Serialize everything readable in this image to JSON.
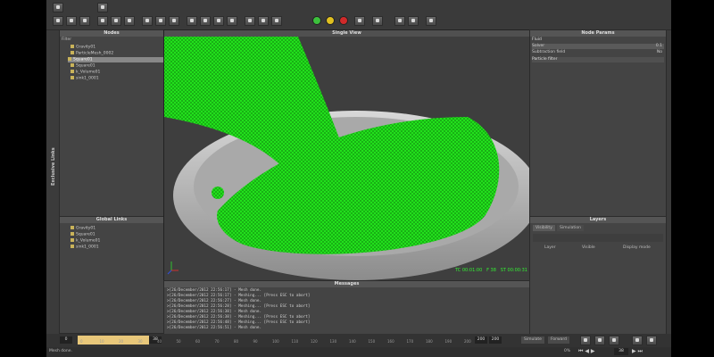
{
  "nodes_panel": {
    "title": "Nodes",
    "filter_label": "Filter",
    "items": [
      {
        "label": "Gravity01"
      },
      {
        "label": "ParticleMesh_0002"
      },
      {
        "label": "Square01"
      },
      {
        "label": "Square01"
      },
      {
        "label": "k_Volume01"
      },
      {
        "label": "sink1_0001"
      }
    ]
  },
  "side_tab": {
    "label": "Exclusive Links"
  },
  "global_links": {
    "title": "Global Links",
    "items": [
      {
        "label": "Gravity01"
      },
      {
        "label": "Square01"
      },
      {
        "label": "k_Volume01"
      },
      {
        "label": "sink1_0001"
      }
    ]
  },
  "viewport": {
    "title": "Single View",
    "hud": {
      "tc": "TC 00:01:00",
      "frame": "F 38",
      "st": "ST 00:00:31"
    }
  },
  "node_params": {
    "title": "Node Params",
    "section": "Fluid",
    "rows": [
      {
        "label": "Solver",
        "value": "0.1"
      },
      {
        "label": "Subtraction field",
        "value": "No"
      }
    ],
    "subsection": "Particle filter"
  },
  "layers": {
    "title": "Layers",
    "tabs": [
      "Visibility",
      "Simulation"
    ],
    "columns": [
      "Layer",
      "Visible",
      "Display mode"
    ]
  },
  "messages": {
    "title": "Messages",
    "lines": [
      ">[26/December/2012 22:56:17] - Mesh done.",
      ">[26/December/2012 22:56:17] - Meshing... [Press ESC to abort]",
      ">[26/December/2012 22:56:27] - Mesh done.",
      ">[26/December/2012 22:56:28] - Meshing... [Press ESC to abort]",
      ">[26/December/2012 22:56:38] - Mesh done.",
      ">[26/December/2012 22:56:38] - Meshing... [Press ESC to abort]",
      ">[26/December/2012 22:56:48] - Meshing... [Press ESC to abort]",
      ">[26/December/2012 22:56:51] - Mesh done."
    ]
  },
  "timeline": {
    "start": "0",
    "ticks": [
      "0",
      "10",
      "20",
      "30",
      "40",
      "50",
      "60",
      "70",
      "80",
      "90",
      "100",
      "110",
      "120",
      "130",
      "140",
      "150",
      "160",
      "170",
      "180",
      "190",
      "200"
    ],
    "end_field": "38",
    "range_a": "200",
    "range_b": "200",
    "simulate_label": "Simulate",
    "mode_label": "Forward",
    "zoom": "0%",
    "frame_field": "38"
  },
  "status_bar": {
    "text": "Mesh done."
  },
  "colors": {
    "mesh": "#22e01c",
    "bg": "#3b3b3b",
    "timeline_range": "#e8c77a",
    "accent_record": "#d02a2a"
  }
}
